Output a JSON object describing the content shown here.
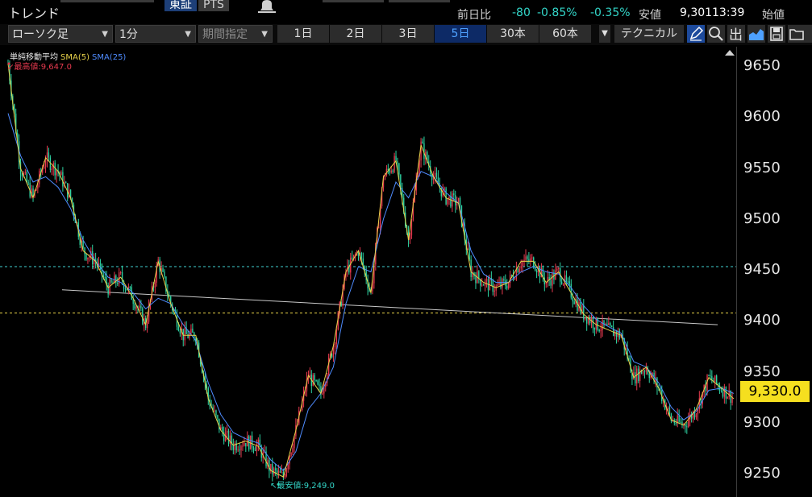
{
  "header": {
    "title": "トレンド",
    "exchange_tabs": [
      {
        "label": "東証",
        "active": true
      },
      {
        "label": "PTS",
        "active": false
      }
    ],
    "change_label": "前日比",
    "change_value": "-80",
    "change_pct": "-0.85%",
    "low_pct": "-0.35%",
    "low_label": "安値",
    "low_value": "9,301",
    "time": "13:39",
    "open_label": "始値",
    "bell_icon": "bell-icon"
  },
  "toolbar": {
    "chart_type": "ローソク足",
    "interval": "1分",
    "period": "期間指定",
    "ranges": [
      "1日",
      "2日",
      "3日",
      "5日",
      "30本",
      "60本"
    ],
    "active_range": "5日",
    "technical": "テクニカル",
    "tools": [
      "pencil-icon",
      "zoom-icon",
      "volume-out-icon",
      "area-chart-icon",
      "save-icon",
      "folder-icon"
    ]
  },
  "chart": {
    "legend_title": "単純移動平均",
    "legend_sma5": "SMA(5)",
    "legend_sma25": "SMA(25)",
    "high_label": "最高値:9,647.0",
    "low_label": "最安値:9,249.0",
    "current_price": "9,330.0",
    "price_ticks": [
      "9650",
      "9600",
      "9550",
      "9500",
      "9450",
      "9400",
      "9350",
      "9300",
      "9250"
    ],
    "colors": {
      "up": "#e83a4f",
      "down": "#2ed3a3",
      "sma5": "#e8d24a",
      "sma25": "#4f8cff",
      "hline_cyan": "#3fd2d2",
      "hline_yellow": "#e8d24a",
      "trendline": "#c8c8c8",
      "price_tag": "#f5df1f"
    }
  },
  "chart_data": {
    "type": "line",
    "title": "",
    "xlabel": "",
    "ylabel": "",
    "ylim": [
      9237,
      9663
    ],
    "y_ticks": [
      9650,
      9600,
      9550,
      9500,
      9450,
      9400,
      9350,
      9300,
      9250
    ],
    "grid": false,
    "legend": "top-left",
    "series": [
      {
        "name": "SMA(5)",
        "values": [
          9647,
          9548,
          9520,
          9558,
          9545,
          9520,
          9470,
          9460,
          9435,
          9445,
          9425,
          9400,
          9460,
          9420,
          9390,
          9390,
          9330,
          9300,
          9286,
          9290,
          9285,
          9262,
          9256,
          9300,
          9352,
          9335,
          9380,
          9450,
          9470,
          9430,
          9540,
          9555,
          9480,
          9570,
          9540,
          9520,
          9515,
          9450,
          9440,
          9435,
          9440,
          9460,
          9460,
          9440,
          9450,
          9430,
          9410,
          9400,
          9395,
          9390,
          9350,
          9360,
          9340,
          9310,
          9305,
          9320,
          9350,
          9340,
          9330
        ]
      },
      {
        "name": "SMA(25)",
        "values": [
          9600,
          9560,
          9535,
          9540,
          9530,
          9510,
          9480,
          9460,
          9445,
          9440,
          9430,
          9415,
          9425,
          9420,
          9400,
          9385,
          9345,
          9315,
          9298,
          9292,
          9288,
          9272,
          9262,
          9280,
          9320,
          9335,
          9360,
          9420,
          9455,
          9450,
          9500,
          9535,
          9520,
          9545,
          9540,
          9525,
          9515,
          9470,
          9448,
          9440,
          9440,
          9450,
          9455,
          9450,
          9448,
          9435,
          9418,
          9405,
          9398,
          9392,
          9365,
          9360,
          9345,
          9322,
          9310,
          9318,
          9338,
          9340,
          9335
        ]
      }
    ],
    "high": 9647.0,
    "low": 9249.0,
    "last": 9330.0,
    "horizontal_lines": [
      9455,
      9411
    ],
    "trendline": [
      [
        9433
      ],
      [
        9400
      ]
    ]
  }
}
